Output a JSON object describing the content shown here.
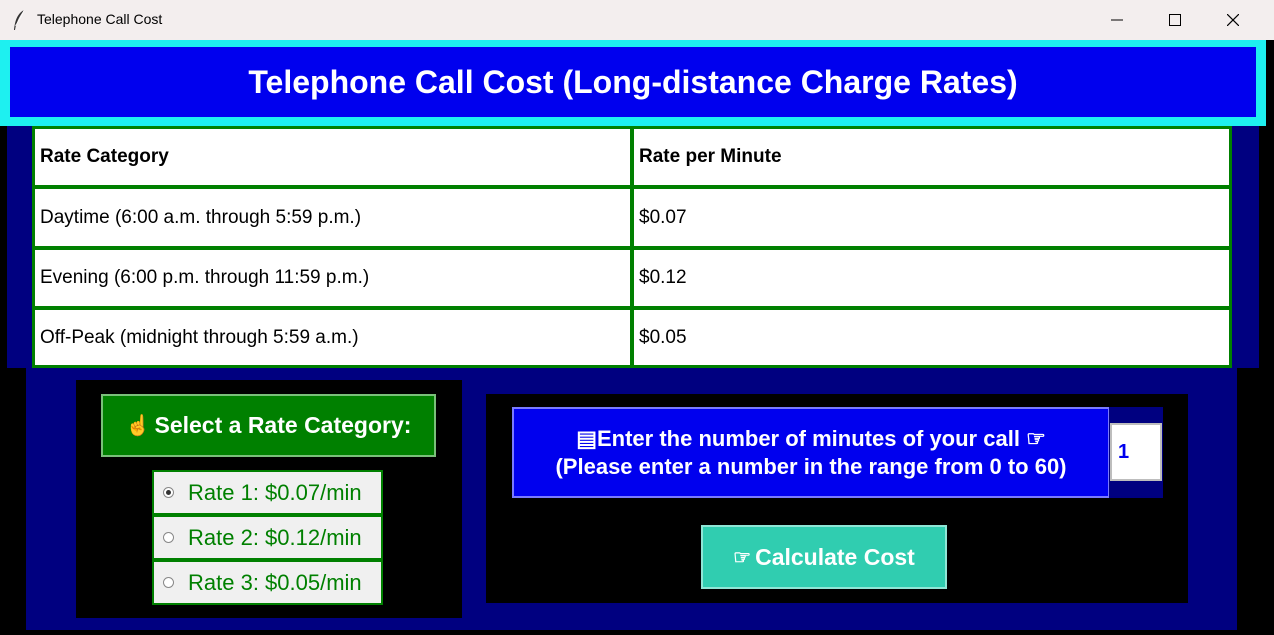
{
  "window": {
    "title": "Telephone Call Cost",
    "app_icon": "feather-icon",
    "controls": [
      "minimize-icon",
      "maximize-icon",
      "close-icon"
    ]
  },
  "header": {
    "title": "Telephone Call Cost (Long-distance Charge Rates)"
  },
  "rates_table": {
    "columns": [
      "Rate Category",
      "Rate per Minute"
    ],
    "rows": [
      [
        "Daytime (6:00 a.m. through 5:59 p.m.)",
        "$0.07"
      ],
      [
        "Evening (6:00 p.m. through 11:59 p.m.)",
        "$0.12"
      ],
      [
        "Off-Peak (midnight through 5:59 a.m.)",
        "$0.05"
      ]
    ]
  },
  "rate_selector": {
    "label": "Select a Rate Category:",
    "icon": "pointing-hand-icon",
    "options": [
      {
        "label": "Rate 1: $0.07/min",
        "checked": true
      },
      {
        "label": "Rate 2: $0.12/min",
        "checked": false
      },
      {
        "label": "Rate 3: $0.05/min",
        "checked": false
      }
    ]
  },
  "minutes": {
    "label_line1": "Enter the number of minutes of your call",
    "label_line2": "(Please enter a number in the range from 0 to 60)",
    "label_icon_left": "keyboard-icon",
    "label_icon_right": "pointing-hand-icon",
    "value": "1"
  },
  "calculate_button": {
    "label": "Calculate Cost",
    "icon": "pointing-hand-icon"
  },
  "colors": {
    "header_bg": "#0000ee",
    "header_border": "#1ef0f0",
    "navy": "#000080",
    "green": "#008000",
    "button_teal": "#30cdb0"
  }
}
